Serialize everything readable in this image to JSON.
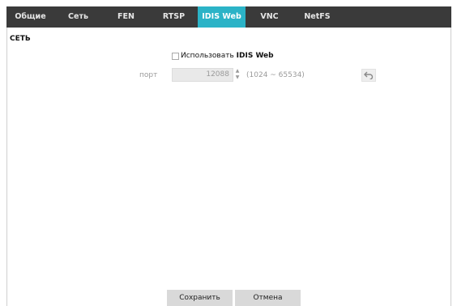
{
  "tabs": [
    {
      "label": "Общие",
      "active": false
    },
    {
      "label": "Сеть",
      "active": false
    },
    {
      "label": "FEN",
      "active": false
    },
    {
      "label": "RTSP",
      "active": false
    },
    {
      "label": "IDIS Web",
      "active": true
    },
    {
      "label": "VNC",
      "active": false
    },
    {
      "label": "NetFS",
      "active": false
    }
  ],
  "section_title": "СЕТЬ",
  "use_idis_web": {
    "prefix": "Использовать ",
    "bold": "IDIS Web",
    "checked": false
  },
  "port": {
    "label": "порт",
    "value": "12088",
    "range": "(1024 ~ 65534)"
  },
  "buttons": {
    "save": "Сохранить",
    "cancel": "Отмена"
  },
  "colors": {
    "tabbar_bg": "#3a3a3a",
    "active_tab": "#2bb3c7"
  },
  "icons": {
    "reset": "undo-arrow-icon",
    "spinner": "spinner-arrows-icon"
  }
}
